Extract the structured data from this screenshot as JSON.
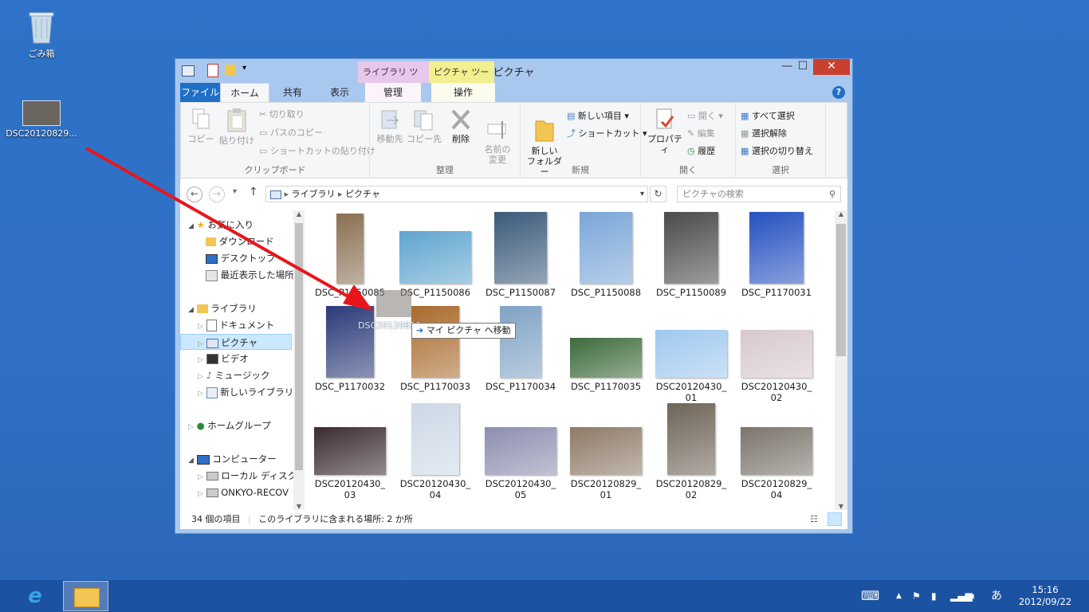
{
  "desktop": {
    "recycle_bin_label": "ごみ箱",
    "dragged_file_label": "DSC20120829...",
    "drag_ghost_label": "DSC20120829_",
    "drag_tooltip": "マイ ピクチャ へ移動"
  },
  "window": {
    "title": "ピクチャ",
    "context_tabs": [
      "ライブラリ ツール",
      "ピクチャ ツール"
    ],
    "context_tab_colors": [
      "#e7c7ec",
      "#f2ef90"
    ],
    "tabs": [
      "ファイル",
      "ホーム",
      "共有",
      "表示",
      "管理",
      "操作"
    ],
    "controls": {
      "minimize": "—",
      "maximize": "☐",
      "close": "✕"
    },
    "help": "?"
  },
  "ribbon": {
    "clipboard": {
      "copy": "コピー",
      "paste": "貼り付け",
      "cut": "切り取り",
      "copy_path": "パスのコピー",
      "paste_shortcut": "ショートカットの貼り付け",
      "label": "クリップボード"
    },
    "organize": {
      "move_to": "移動先",
      "copy_to": "コピー先",
      "delete": "削除",
      "rename": "名前の\n変更",
      "label": "整理"
    },
    "new": {
      "new_folder": "新しい\nフォルダー",
      "new_item": "新しい項目",
      "shortcut": "ショートカット",
      "label": "新規"
    },
    "open": {
      "properties": "プロパティ",
      "open": "開く",
      "edit": "編集",
      "history": "履歴",
      "label": "開く"
    },
    "select": {
      "select_all": "すべて選択",
      "select_none": "選択解除",
      "invert": "選択の切り替え",
      "label": "選択"
    }
  },
  "address": {
    "crumbs": [
      "ライブラリ",
      "ピクチャ"
    ],
    "search_placeholder": "ピクチャの検索"
  },
  "nav": [
    {
      "label": "お気に入り",
      "icon": "star-icon"
    },
    {
      "label": "ダウンロード",
      "icon": "download-folder-icon"
    },
    {
      "label": "デスクトップ",
      "icon": "desktop-icon"
    },
    {
      "label": "最近表示した場所",
      "icon": "recent-places-icon"
    },
    {
      "label": "ライブラリ",
      "icon": "library-icon"
    },
    {
      "label": "ドキュメント",
      "icon": "documents-icon"
    },
    {
      "label": "ピクチャ",
      "icon": "pictures-icon"
    },
    {
      "label": "ビデオ",
      "icon": "videos-icon"
    },
    {
      "label": "ミュージック",
      "icon": "music-icon"
    },
    {
      "label": "新しいライブラリ",
      "icon": "new-library-icon"
    },
    {
      "label": "ホームグループ",
      "icon": "homegroup-icon"
    },
    {
      "label": "コンピューター",
      "icon": "computer-icon"
    },
    {
      "label": "ローカル ディスク (C",
      "icon": "local-disk-icon"
    },
    {
      "label": "ONKYO-RECOV",
      "icon": "drive-icon"
    }
  ],
  "files": [
    {
      "name": "DSC_P1150085",
      "color": "#8a6f52"
    },
    {
      "name": "DSC_P1150086",
      "color": "#5fa5cf"
    },
    {
      "name": "DSC_P1150087",
      "color": "#3b5a7a"
    },
    {
      "name": "DSC_P1150088",
      "color": "#7aa6d8"
    },
    {
      "name": "DSC_P1150089",
      "color": "#4a4a48"
    },
    {
      "name": "DSC_P1170031",
      "color": "#2450c0"
    },
    {
      "name": "DSC_P1170032",
      "color": "#2b3a78"
    },
    {
      "name": "DSC_P1170033",
      "color": "#a86a2c"
    },
    {
      "name": "DSC_P1170034",
      "color": "#7fa2c4"
    },
    {
      "name": "DSC_P1170035",
      "color": "#3c6a3a"
    },
    {
      "name": "DSC20120430_\n01",
      "color": "#9fc8ef"
    },
    {
      "name": "DSC20120430_\n02",
      "color": "#d7c9cf"
    },
    {
      "name": "DSC20120430_\n03",
      "color": "#3a2a30"
    },
    {
      "name": "DSC20120430_\n04",
      "color": "#cdd8e6"
    },
    {
      "name": "DSC20120430_\n05",
      "color": "#8d8eaf"
    },
    {
      "name": "DSC20120829_\n01",
      "color": "#8e7a68"
    },
    {
      "name": "DSC20120829_\n02",
      "color": "#6e6458"
    },
    {
      "name": "DSC20120829_\n04",
      "color": "#7b746c"
    }
  ],
  "status": {
    "count": "34 個の項目",
    "locations": "このライブラリに含まれる場所: 2 か所"
  },
  "taskbar": {
    "ime": "あ",
    "time": "15:16",
    "date": "2012/09/22"
  }
}
